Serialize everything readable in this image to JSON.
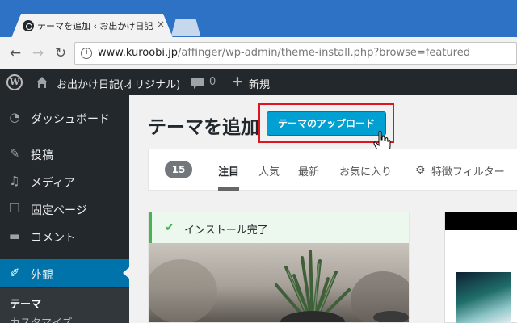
{
  "browser": {
    "tab_title": "テーマを追加 ‹ お出かけ日記",
    "tab_close": "×",
    "url_host": "www.kuroobi.jp",
    "url_path": "/affinger/wp-admin/theme-install.php?browse=featured",
    "back_glyph": "←",
    "forward_glyph": "→",
    "reload_glyph": "↻",
    "info_glyph": "i"
  },
  "adminbar": {
    "wp_glyph": "W",
    "site_name": "お出かけ日記(オリジナル)",
    "comments_count": "0",
    "plus_glyph": "+",
    "new_label": "新規"
  },
  "sidebar": {
    "items": [
      {
        "label": "ダッシュボード",
        "icon": "dashboard-icon",
        "glyph": "◔"
      },
      {
        "label": "投稿",
        "icon": "pin-icon",
        "glyph": "✎"
      },
      {
        "label": "メディア",
        "icon": "media-icon",
        "glyph": "♫"
      },
      {
        "label": "固定ページ",
        "icon": "page-icon",
        "glyph": "❐"
      },
      {
        "label": "コメント",
        "icon": "comment-icon",
        "glyph": "▬"
      },
      {
        "label": "外観",
        "icon": "brush-icon",
        "glyph": "✐"
      }
    ],
    "submenu": {
      "current": "テーマ",
      "next": "カスタマイズ"
    }
  },
  "main": {
    "page_title": "テーマを追加",
    "upload_button": "テーマのアップロード",
    "filter": {
      "count": "15",
      "tabs": [
        "注目",
        "人気",
        "最新",
        "お気に入り"
      ],
      "feature_filter": "特徴フィルター",
      "gear_glyph": "⚙"
    },
    "notice": {
      "check_glyph": "✔",
      "text": "インストール完了"
    }
  },
  "colors": {
    "admin_dark": "#23282d",
    "admin_blue": "#0073aa",
    "button_blue": "#00a0d2",
    "highlight_red": "#e0141e",
    "success_green": "#46b450"
  }
}
